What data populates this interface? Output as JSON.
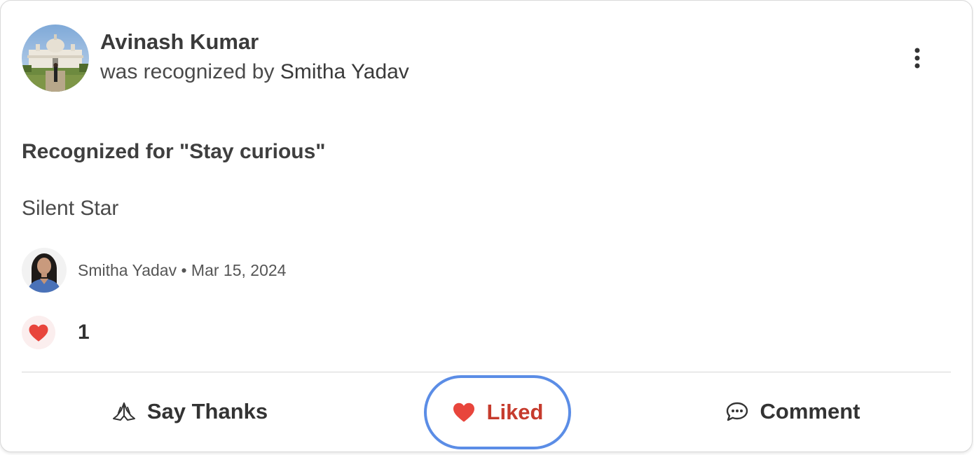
{
  "post": {
    "recipient_name": "Avinash Kumar",
    "recognized_by_prefix": "was recognized by ",
    "recognized_by_name": "Smitha Yadav",
    "headline": "Recognized for \"Stay curious\"",
    "message": "Silent Star",
    "author_name": "Smitha Yadav",
    "separator": " • ",
    "date": "Mar 15, 2024",
    "like_count": "1"
  },
  "actions": {
    "say_thanks": "Say Thanks",
    "liked": "Liked",
    "comment": "Comment"
  },
  "icons": {
    "more": "more-vertical-icon",
    "heart": "heart-icon",
    "thanks": "praying-hands-icon",
    "comment": "speech-bubble-icon"
  },
  "colors": {
    "like_red": "#e8453c",
    "liked_text": "#c63b2d",
    "focus_ring": "#5b8de6"
  }
}
